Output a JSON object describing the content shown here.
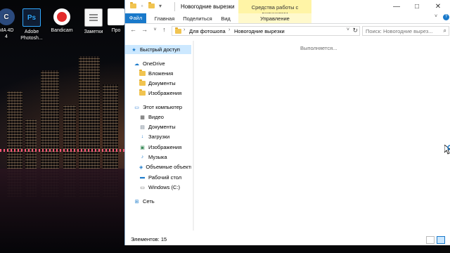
{
  "desktop": {
    "icons": [
      {
        "label": "MA 4D\n4",
        "icon": "cinema4d-icon"
      },
      {
        "label": "Adobe\nPhotosh...",
        "icon": "photoshop-icon",
        "glyph": "Ps"
      },
      {
        "label": "Bandicam",
        "icon": "bandicam-icon"
      },
      {
        "label": "Заметки",
        "icon": "notes-icon"
      },
      {
        "label": "Про",
        "icon": "app-icon"
      }
    ],
    "right_edge_text": "ffice"
  },
  "window": {
    "title": "Новогодние вырезки",
    "context_tools": "Средства работы с рисунками",
    "ribbon_tabs": [
      "Файл",
      "Главная",
      "Поделиться",
      "Вид",
      "Управление"
    ],
    "address": {
      "crumbs": [
        "Для фотошопа",
        "Новогодние вырезки"
      ]
    },
    "search": {
      "placeholder": "Поиск: Новогодние вырез..."
    },
    "navpane": {
      "items": [
        {
          "label": "Быстрый доступ",
          "icon": "star-icon",
          "selected": true
        },
        {
          "label": "OneDrive",
          "icon": "cloud-icon"
        },
        {
          "label": "Вложения",
          "icon": "folder-icon"
        },
        {
          "label": "Документы",
          "icon": "folder-icon"
        },
        {
          "label": "Изображения",
          "icon": "folder-icon"
        },
        {
          "label": "Этот компьютер",
          "icon": "computer-icon"
        },
        {
          "label": "Видео",
          "icon": "video-icon"
        },
        {
          "label": "Документы",
          "icon": "documents-icon"
        },
        {
          "label": "Загрузки",
          "icon": "download-icon"
        },
        {
          "label": "Изображения",
          "icon": "pictures-icon"
        },
        {
          "label": "Музыка",
          "icon": "music-icon"
        },
        {
          "label": "Объемные объекты",
          "icon": "3d-objects-icon"
        },
        {
          "label": "Рабочий стол",
          "icon": "desktop-icon"
        },
        {
          "label": "Windows (C:)",
          "icon": "drive-icon"
        },
        {
          "label": "Сеть",
          "icon": "network-icon"
        }
      ]
    },
    "content": {
      "status_message": "Выполняется..."
    },
    "statusbar": {
      "items_count": "Элементов: 15"
    },
    "colors": {
      "accent": "#1979ca",
      "context_tab": "#fff4a6",
      "selection": "#cce8ff"
    }
  }
}
